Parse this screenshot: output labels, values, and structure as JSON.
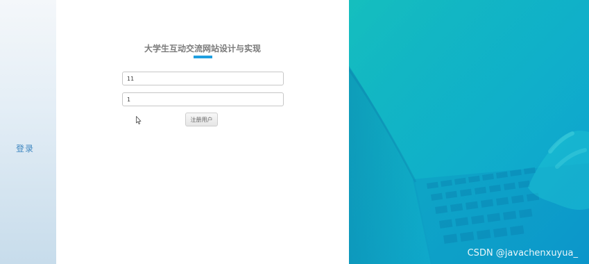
{
  "sidebar": {
    "login_label": "登录"
  },
  "form": {
    "title": "大学生互动交流网站设计与实现",
    "username_value": "11",
    "password_value": "1",
    "register_label": "注册用户"
  },
  "watermark": "CSDN @javachenxuyua_",
  "colors": {
    "accent": "#1f9fe0",
    "sidebar_link": "#3f87c0",
    "hero_start": "#12b8c0",
    "hero_end": "#0ea2d4"
  },
  "icons": {
    "cursor": "mouse-pointer-icon"
  }
}
